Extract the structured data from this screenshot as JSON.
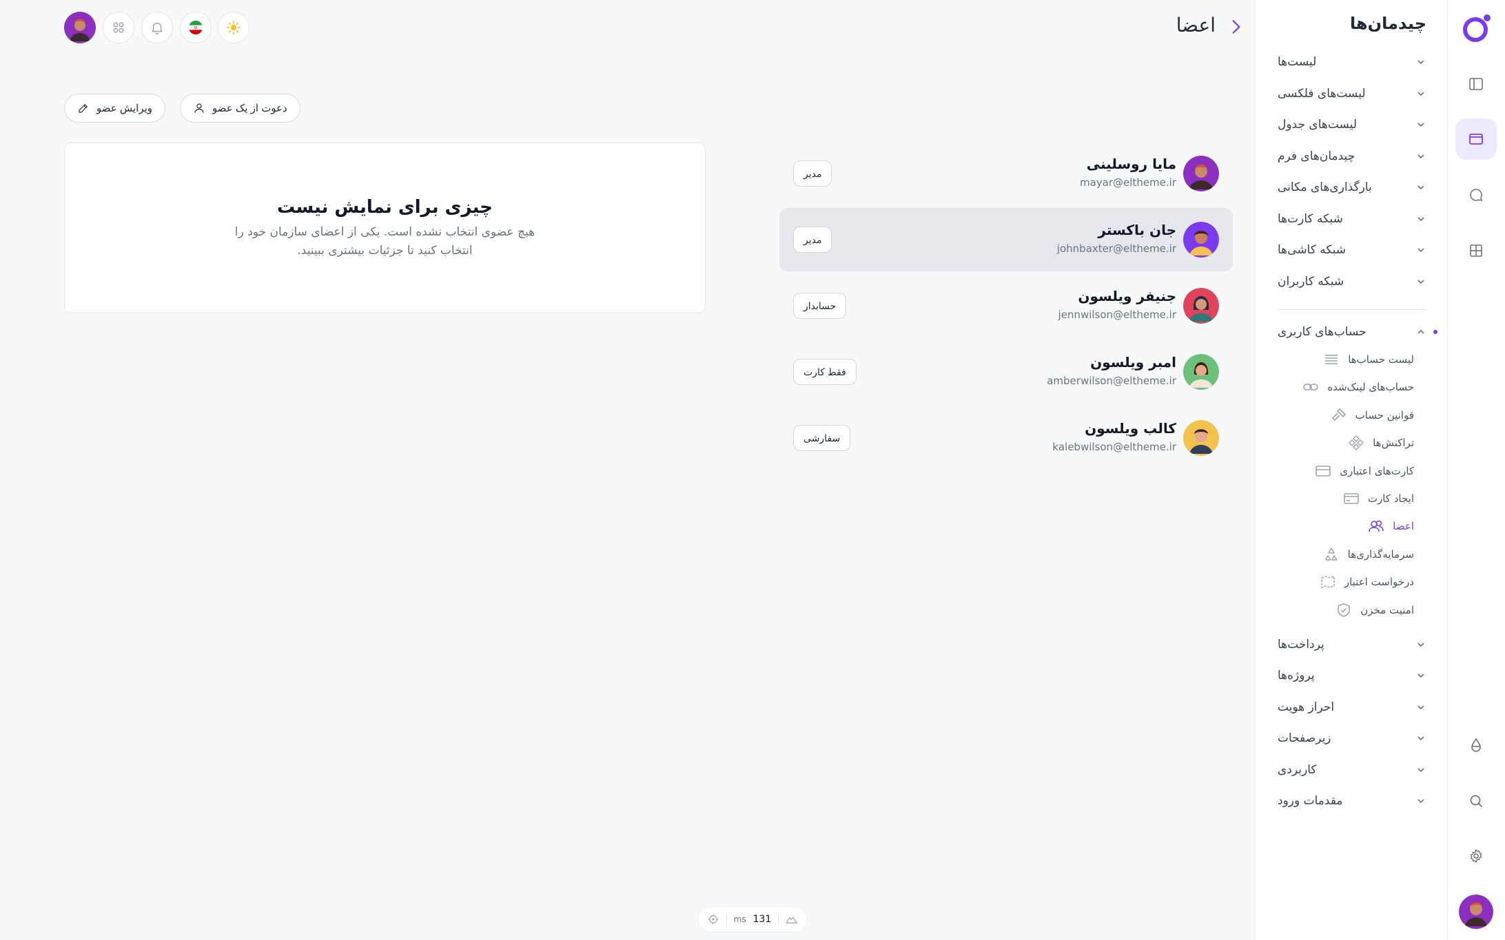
{
  "header": {
    "title": "اعضا",
    "back_icon": "chevron-right-icon",
    "toolbar_icons": [
      "sun-icon",
      "iran-flag-icon",
      "bell-icon",
      "apps-grid-icon",
      "user-avatar"
    ]
  },
  "actions": {
    "invite_label": "دعوت از یک عضو",
    "edit_label": "ویرایش عضو"
  },
  "members": [
    {
      "name": "مایا روسلینی",
      "email": "mayar@eltheme.ir",
      "role": "مدیر",
      "selected": false
    },
    {
      "name": "جان باکستر",
      "email": "johnbaxter@eltheme.ir",
      "role": "مدیر",
      "selected": true
    },
    {
      "name": "جنیفر ویلسون",
      "email": "jennwilson@eltheme.ir",
      "role": "حسابدار",
      "selected": false
    },
    {
      "name": "امبر ویلسون",
      "email": "amberwilson@eltheme.ir",
      "role": "فقط کارت",
      "selected": false
    },
    {
      "name": "کالب ویلسون",
      "email": "kalebwilson@eltheme.ir",
      "role": "سفارشی",
      "selected": false
    }
  ],
  "empty_state": {
    "title": "چیزی برای نمایش نیست",
    "description": "هیچ عضوی انتخاب نشده است. یکی از اعضای سازمان خود را انتخاب کنید تا جزئیات بیشتری ببینید."
  },
  "sidebar": {
    "title": "چیدمان‌ها",
    "groups_top": [
      "لیست‌ها",
      "لیست‌های فلکسی",
      "لیست‌های جدول",
      "چیدمان‌های فرم",
      "بارگذاری‌های مکانی",
      "شبکه کارت‌ها",
      "شبکه کاشی‌ها",
      "شبکه کاربران"
    ],
    "open_group": "حساب‌های کاربری",
    "sub_items": [
      {
        "label": "لیست حساب‌ها",
        "icon": "list-icon"
      },
      {
        "label": "حساب‌های لینک‌شده",
        "icon": "link-icon"
      },
      {
        "label": "قوانین حساب",
        "icon": "gavel-icon"
      },
      {
        "label": "تراکنش‌ها",
        "icon": "transactions-icon"
      },
      {
        "label": "کارت‌های اعتباری",
        "icon": "credit-card-icon"
      },
      {
        "label": "ایجاد کارت",
        "icon": "card-add-icon"
      },
      {
        "label": "اعضا",
        "icon": "users-icon",
        "active": true
      },
      {
        "label": "سرمایه‌گذاری‌ها",
        "icon": "recycle-icon"
      },
      {
        "label": "درخواست اعتبار",
        "icon": "map-icon"
      },
      {
        "label": "امنیت مخزن",
        "icon": "shield-check-icon"
      }
    ],
    "groups_bottom": [
      "پرداخت‌ها",
      "پروژه‌ها",
      "احراز هویت",
      "زیرصفحات",
      "کاربردی",
      "مقدمات ورود"
    ]
  },
  "rail": {
    "icons": [
      "sidebar-icon",
      "layout-icon",
      "chat-icon",
      "grid-icon",
      "drop-icon",
      "search-icon",
      "gear-icon"
    ]
  },
  "perf": {
    "value": "131",
    "unit": "ms"
  },
  "colors": {
    "accent": "#7c3aed",
    "selected_row": "#e5e7ec",
    "background": "#f7f8fa"
  }
}
